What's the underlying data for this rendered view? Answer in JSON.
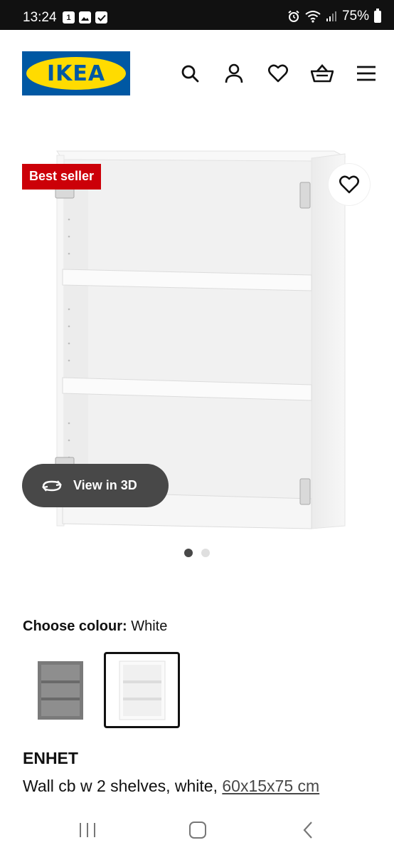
{
  "status_bar": {
    "time": "13:24",
    "battery": "75%",
    "left_icons": [
      "calendar-icon",
      "gallery-icon",
      "check-icon"
    ],
    "right_icons": [
      "alarm-icon",
      "wifi-icon",
      "signal-icon",
      "battery-icon"
    ]
  },
  "header": {
    "logo_text": "IKEA",
    "icons": [
      "search-icon",
      "account-icon",
      "heart-icon",
      "basket-icon",
      "menu-icon"
    ]
  },
  "gallery": {
    "badge": "Best seller",
    "view_3d_label": "View in 3D",
    "image_count": 2,
    "active_image": 1
  },
  "colour": {
    "label": "Choose colour:",
    "selected": "White",
    "options": [
      "Grey",
      "White"
    ]
  },
  "product": {
    "name": "ENHET",
    "description": "Wall cb w 2 shelves, white,",
    "dimensions": "60x15x75 cm"
  },
  "colors": {
    "logo_blue": "#0058a3",
    "logo_yellow": "#ffdb00",
    "badge_red": "#cc0008",
    "pill_dark": "#484848"
  },
  "nav_bar": [
    "recents-icon",
    "home-icon",
    "back-icon"
  ]
}
